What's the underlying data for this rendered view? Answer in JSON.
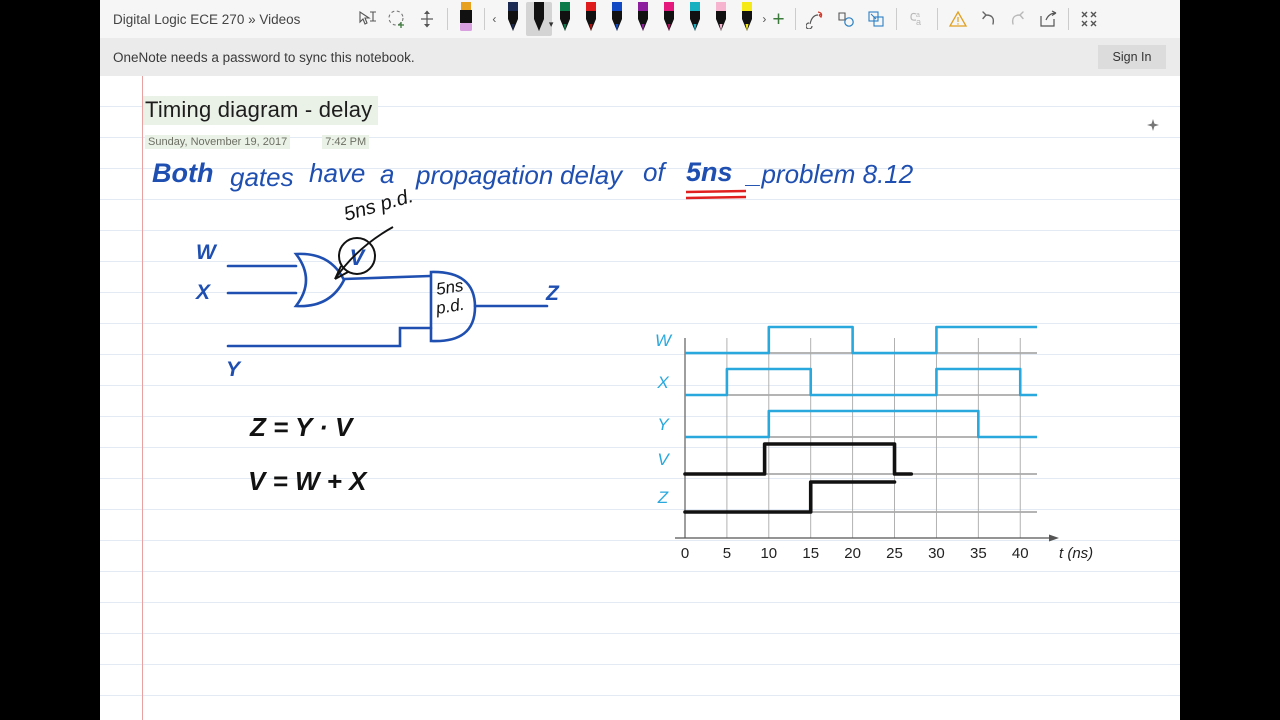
{
  "window": {
    "breadcrumb": "Digital Logic ECE 270 » Videos"
  },
  "toolbar": {
    "icons": [
      {
        "name": "lasso-select-icon",
        "glyph": "select"
      },
      {
        "name": "insert-space-icon",
        "glyph": "insert"
      },
      {
        "name": "vertical-resize-icon",
        "glyph": "resize"
      }
    ],
    "eraser_label": "Eraser",
    "prev_pen_label": "‹",
    "more_pens_label": "›",
    "add_pen_label": "+",
    "pens": [
      {
        "name": "pen-navy",
        "body": "#1b2a52",
        "tip": "#1b2a52",
        "cap": "#1b2a52",
        "selected": false
      },
      {
        "name": "pen-black",
        "body": "#111111",
        "tip": "#111111",
        "cap": "#111111",
        "selected": true
      },
      {
        "name": "pen-green",
        "body": "#0d7a4a",
        "tip": "#0d7a4a",
        "cap": "#0d7a4a",
        "selected": false
      },
      {
        "name": "pen-red",
        "body": "#e01b1b",
        "tip": "#b01010",
        "cap": "#e01b1b",
        "selected": false
      },
      {
        "name": "pen-blue",
        "body": "#1149c4",
        "tip": "#1149c4",
        "cap": "#1149c4",
        "selected": false
      },
      {
        "name": "pen-purple",
        "body": "#8d1f9e",
        "tip": "#8d1f9e",
        "cap": "#8d1f9e",
        "selected": false
      },
      {
        "name": "pen-magenta",
        "body": "#e5197d",
        "tip": "#b2125f",
        "cap": "#e5197d",
        "selected": false
      },
      {
        "name": "pen-teal",
        "body": "#17b0c0",
        "tip": "#17b0c0",
        "cap": "#17b0c0",
        "selected": false
      },
      {
        "name": "highlighter-pink",
        "body": "#f7b4cf",
        "tip": "#f7b4cf",
        "cap": "#f7b4cf",
        "selected": false
      },
      {
        "name": "highlighter-yellow",
        "body": "#f5ea18",
        "tip": "#f5ea18",
        "cap": "#f5ea18",
        "selected": false
      }
    ],
    "right_icons": [
      {
        "name": "ink-to-shape-icon",
        "label": "ink-to-shape"
      },
      {
        "name": "ink-to-text-icon",
        "label": "ink-to-text"
      },
      {
        "name": "ink-to-math-icon",
        "label": "ink-to-math"
      },
      {
        "name": "replay-ink-icon",
        "label": "replay-ink"
      },
      {
        "name": "warning-icon",
        "label": "warning"
      },
      {
        "name": "undo-icon",
        "label": "undo"
      },
      {
        "name": "redo-icon",
        "label": "redo"
      },
      {
        "name": "share-icon",
        "label": "share"
      },
      {
        "name": "collapse-ribbon-icon",
        "label": "collapse"
      }
    ]
  },
  "sync": {
    "message": "OneNote needs a password to sync this notebook.",
    "sign_in_label": "Sign In"
  },
  "page": {
    "title": "Timing diagram -  delay",
    "date": "Sunday, November 19, 2017",
    "time": "7:42 PM",
    "move_handle": "move-page-handle"
  },
  "notes": {
    "headline_words": [
      "Both",
      "gates",
      "have",
      "a",
      "propagation",
      "delay",
      "of"
    ],
    "headline_text": "Both gates have a propagation delay of",
    "emphasis": "5ns",
    "problem_ref": "_problem  8.12",
    "underline_color": "#e02020",
    "ink_blue": "#1f4fb0",
    "ink_black": "#121212",
    "gate_delay_note": "5ns p.d.",
    "and_gate_label_line1": "5ns",
    "and_gate_label_line2": "p.d.",
    "node_label": "V",
    "input_w": "W",
    "input_x": "X",
    "input_y": "Y",
    "output_z": "Z",
    "equation_1": "Z = Y · V",
    "equation_2": "V = W + X"
  },
  "chart_data": {
    "type": "line",
    "title": "Timing diagram",
    "xlabel": "t (ns)",
    "ylabel": "",
    "grid": true,
    "xlim": [
      0,
      42
    ],
    "xticks": [
      0,
      5,
      10,
      15,
      20,
      25,
      30,
      35,
      40
    ],
    "xticklabels": [
      "0",
      "5",
      "10",
      "15",
      "20",
      "25",
      "30",
      "35",
      "40"
    ],
    "axis_unit_label": "t",
    "axis_unit_paren": "(ns)",
    "signal_color": "#29a8dd",
    "derived_color": "#111111",
    "legend_position": "left-axis-labels",
    "series": [
      {
        "name": "W",
        "style": "printed",
        "color": "#29a8dd",
        "transitions": [
          [
            0,
            0
          ],
          [
            10,
            1
          ],
          [
            20,
            0
          ],
          [
            30,
            1
          ],
          [
            42,
            1
          ]
        ],
        "description": "low 0-10, high 10-20, low 20-30, high 30-42"
      },
      {
        "name": "X",
        "style": "printed",
        "color": "#29a8dd",
        "transitions": [
          [
            0,
            0
          ],
          [
            5,
            1
          ],
          [
            15,
            0
          ],
          [
            30,
            1
          ],
          [
            40,
            0
          ],
          [
            42,
            0
          ]
        ],
        "description": "low 0-5, high 5-15, low 15-30, high 30-40, low 40-42"
      },
      {
        "name": "Y",
        "style": "printed",
        "color": "#29a8dd",
        "transitions": [
          [
            0,
            0
          ],
          [
            10,
            1
          ],
          [
            35,
            0
          ],
          [
            42,
            0
          ]
        ],
        "description": "low 0-10, high 10-35, low 35-42"
      },
      {
        "name": "V",
        "style": "handwritten",
        "color": "#111111",
        "transitions": [
          [
            0,
            0
          ],
          [
            9.5,
            1
          ],
          [
            25,
            0
          ],
          [
            27,
            0
          ]
        ],
        "description": "hand drawn: low 0-9.5, high 9.5-25, low 25-27 (ends)"
      },
      {
        "name": "Z",
        "style": "handwritten",
        "color": "#111111",
        "transitions": [
          [
            0,
            0
          ],
          [
            15,
            1
          ],
          [
            25,
            1
          ]
        ],
        "description": "hand drawn: low 0-15, high 15-25 (ends)"
      }
    ]
  }
}
